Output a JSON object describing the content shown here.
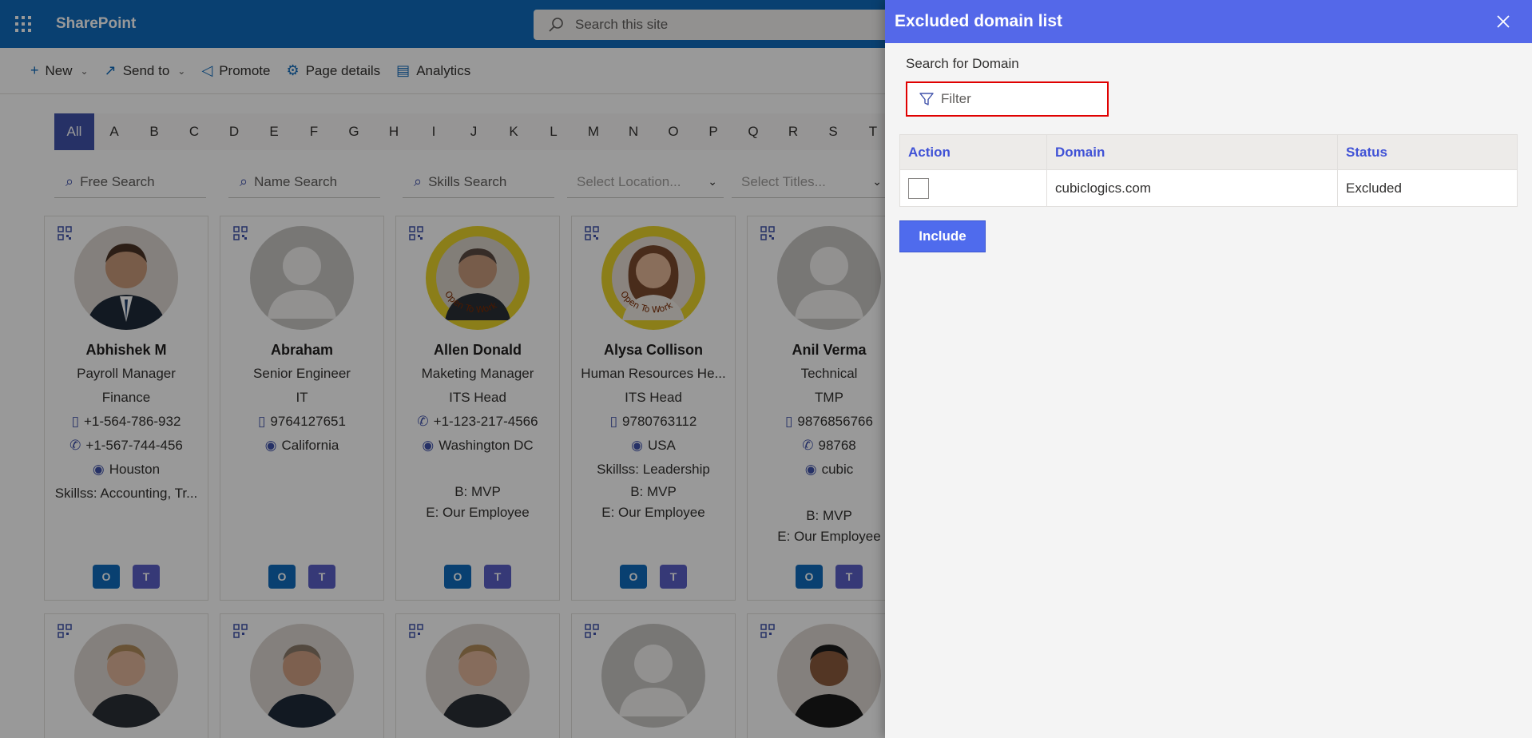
{
  "suite": {
    "title": "SharePoint",
    "search_placeholder": "Search this site"
  },
  "commands": [
    {
      "label": "New",
      "icon": "plus-icon",
      "has_dropdown": true
    },
    {
      "label": "Send to",
      "icon": "share-icon",
      "has_dropdown": true
    },
    {
      "label": "Promote",
      "icon": "megaphone-icon",
      "has_dropdown": false
    },
    {
      "label": "Page details",
      "icon": "gear-icon",
      "has_dropdown": false
    },
    {
      "label": "Analytics",
      "icon": "chart-icon",
      "has_dropdown": false
    }
  ],
  "alphabet": [
    "All",
    "A",
    "B",
    "C",
    "D",
    "E",
    "F",
    "G",
    "H",
    "I",
    "J",
    "K",
    "L",
    "M",
    "N",
    "O",
    "P",
    "Q",
    "R",
    "S",
    "T"
  ],
  "filters": {
    "free_search": "Free Search",
    "name_search": "Name Search",
    "skills_search": "Skills Search",
    "location": "Select Location...",
    "titles": "Select Titles..."
  },
  "people": [
    {
      "name": "Abhishek M",
      "lines": [
        "Payroll Manager",
        "Finance",
        "+1-564-786-932",
        "+1-567-744-456",
        "Houston",
        "Skillss: Accounting, Tr..."
      ]
    },
    {
      "name": "Abraham",
      "lines": [
        "Senior Engineer",
        "IT",
        "9764127651",
        "California"
      ]
    },
    {
      "name": "Allen Donald",
      "lines": [
        "Maketing Manager",
        "ITS Head",
        "+1-123-217-4566",
        "Washington DC",
        "",
        "B: MVP",
        "E: Our Employee"
      ]
    },
    {
      "name": "Alysa Collison",
      "lines": [
        "Human Resources He...",
        "ITS Head",
        "9780763112",
        "USA",
        "Skillss: Leadership",
        "B: MVP",
        "E: Our Employee"
      ]
    },
    {
      "name": "Anil Verma",
      "lines": [
        "Technical",
        "TMP",
        "9876856766",
        "98768",
        "cubic",
        "",
        "B: MVP",
        "E: Our Employee"
      ]
    }
  ],
  "badges": {
    "open_to_work": "Open To Work"
  },
  "panel": {
    "title": "Excluded domain list",
    "search_label": "Search for Domain",
    "filter_placeholder": "Filter",
    "columns": [
      "Action",
      "Domain",
      "Status"
    ],
    "rows": [
      {
        "domain": "cubiclogics.com",
        "status": "Excluded"
      }
    ],
    "include_label": "Include"
  },
  "colors": {
    "suite_bar": "#0f6cbd",
    "panel_header": "#5468e9",
    "accent": "#4052ab",
    "filter_highlight": "#e00000"
  }
}
